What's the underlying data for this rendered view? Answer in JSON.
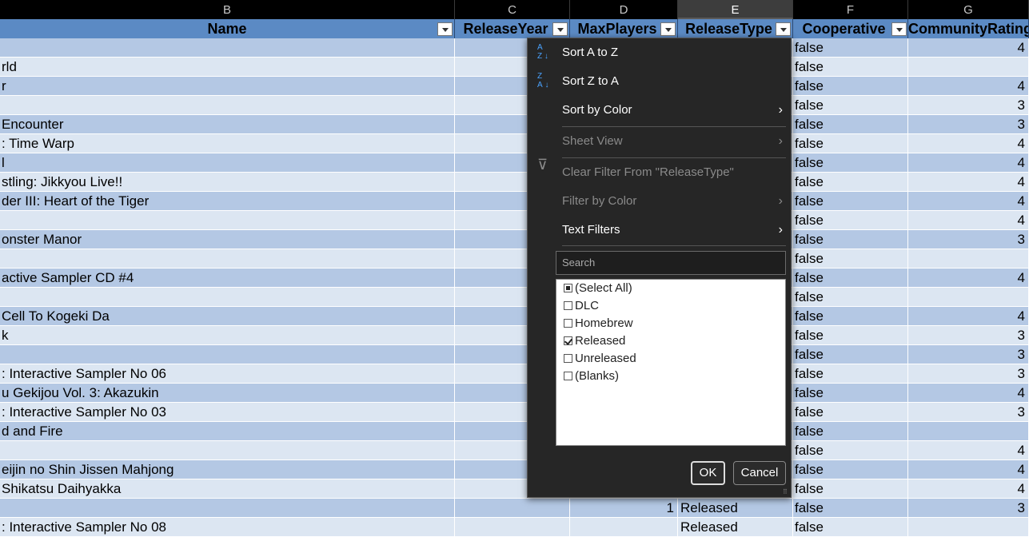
{
  "column_letters": [
    "B",
    "C",
    "D",
    "E",
    "F",
    "G"
  ],
  "headers": {
    "name": "Name",
    "release_year": "ReleaseYear",
    "max_players": "MaxPlayers",
    "release_type": "ReleaseType",
    "cooperative": "Cooperative",
    "community_rating": "CommunityRating"
  },
  "rows": [
    {
      "name": "",
      "d": "",
      "e": "",
      "f": "false",
      "g": "4"
    },
    {
      "name": "rld",
      "d": "",
      "e": "",
      "f": "false",
      "g": ""
    },
    {
      "name": "r",
      "d": "",
      "e": "",
      "f": "false",
      "g": "4"
    },
    {
      "name": "",
      "d": "",
      "e": "",
      "f": "false",
      "g": "3"
    },
    {
      "name": "Encounter",
      "d": "",
      "e": "",
      "f": "false",
      "g": "3"
    },
    {
      "name": ": Time Warp",
      "d": "",
      "e": "",
      "f": "false",
      "g": "4"
    },
    {
      "name": "l",
      "d": "",
      "e": "",
      "f": "false",
      "g": "4"
    },
    {
      "name": "stling: Jikkyou Live!!",
      "d": "",
      "e": "",
      "f": "false",
      "g": "4"
    },
    {
      "name": "der III: Heart of the Tiger",
      "d": "",
      "e": "",
      "f": "false",
      "g": "4"
    },
    {
      "name": "",
      "d": "",
      "e": "",
      "f": "false",
      "g": "4"
    },
    {
      "name": "onster Manor",
      "d": "",
      "e": "",
      "f": "false",
      "g": "3"
    },
    {
      "name": "",
      "d": "",
      "e": "",
      "f": "false",
      "g": ""
    },
    {
      "name": "active Sampler CD #4",
      "d": "",
      "e": "",
      "f": "false",
      "g": "4"
    },
    {
      "name": "",
      "d": "",
      "e": "",
      "f": "false",
      "g": ""
    },
    {
      "name": "Cell To Kogeki Da",
      "d": "",
      "e": "",
      "f": "false",
      "g": "4"
    },
    {
      "name": "k",
      "d": "",
      "e": "",
      "f": "false",
      "g": "3"
    },
    {
      "name": "",
      "d": "",
      "e": "",
      "f": "false",
      "g": "3"
    },
    {
      "name": ": Interactive Sampler No 06",
      "d": "",
      "e": "",
      "f": "false",
      "g": "3"
    },
    {
      "name": "u Gekijou Vol. 3: Akazukin",
      "d": "",
      "e": "",
      "f": "false",
      "g": "4"
    },
    {
      "name": ": Interactive Sampler No 03",
      "d": "",
      "e": "",
      "f": "false",
      "g": "3"
    },
    {
      "name": "d and Fire",
      "d": "",
      "e": "",
      "f": "false",
      "g": ""
    },
    {
      "name": "",
      "d": "",
      "e": "",
      "f": "false",
      "g": "4"
    },
    {
      "name": "eijin no Shin Jissen Mahjong",
      "d": "",
      "e": "",
      "f": "false",
      "g": "4"
    },
    {
      "name": "Shikatsu Daihyakka",
      "d": "",
      "e": "",
      "f": "false",
      "g": "4"
    },
    {
      "name": "",
      "d": "1",
      "e": "Released",
      "f": "false",
      "g": "3"
    },
    {
      "name": ": Interactive Sampler No 08",
      "d": "",
      "e": "Released",
      "f": "false",
      "g": ""
    }
  ],
  "filter_menu": {
    "sort_az": "Sort A to Z",
    "sort_za": "Sort Z to A",
    "sort_by_color": "Sort by Color",
    "sheet_view": "Sheet View",
    "clear_filter": "Clear Filter From \"ReleaseType\"",
    "filter_by_color": "Filter by Color",
    "text_filters": "Text Filters",
    "search_placeholder": "Search",
    "items": [
      {
        "label": "(Select All)",
        "state": "partial"
      },
      {
        "label": "DLC",
        "state": "unchecked"
      },
      {
        "label": "Homebrew",
        "state": "unchecked"
      },
      {
        "label": "Released",
        "state": "checked"
      },
      {
        "label": "Unreleased",
        "state": "unchecked"
      },
      {
        "label": "(Blanks)",
        "state": "unchecked"
      }
    ],
    "ok": "OK",
    "cancel": "Cancel"
  },
  "colors": {
    "header_fill": "#5b8ac4",
    "row_dark": "#b4c8e4",
    "row_light": "#dce6f2",
    "panel_bg": "#262626"
  }
}
